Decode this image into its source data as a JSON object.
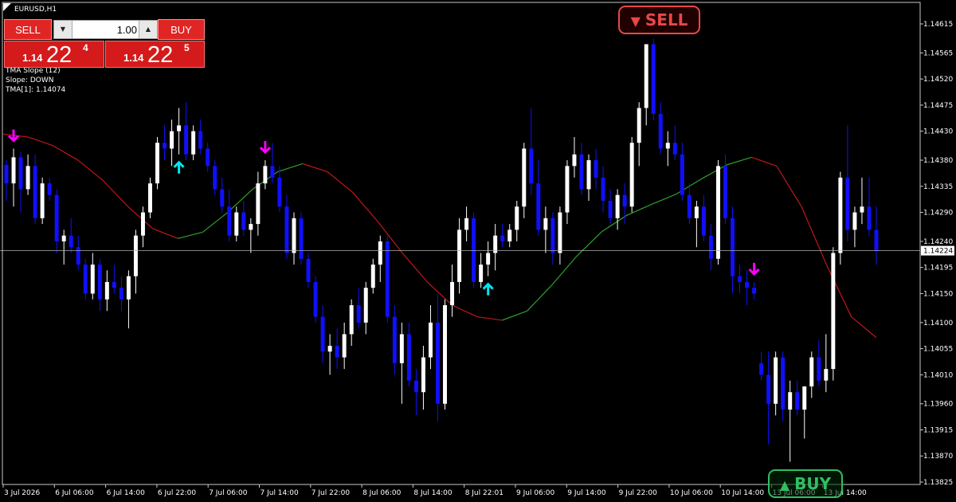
{
  "window": {
    "symbol_title": "EURUSD,H1"
  },
  "trade_panel": {
    "sell_label": "SELL",
    "buy_label": "BUY",
    "lot_value": "1.00",
    "sell_price": {
      "prefix": "1.14",
      "big": "22",
      "sup": "4"
    },
    "buy_price": {
      "prefix": "1.14",
      "big": "22",
      "sup": "5"
    }
  },
  "indicator": {
    "line1": "TMA Slope (12)",
    "line2": "Slope: DOWN",
    "line3": "TMA[1]: 1.14074"
  },
  "signals": {
    "sell_badge": "SELL",
    "buy_badge": "BUY"
  },
  "colors": {
    "background": "#000000",
    "bull_candle": "#ffffff",
    "bear_candle": "#1010ff",
    "tma_up": "#2ea02e",
    "tma_down": "#c01818",
    "arrow_down": "#ff00ff",
    "arrow_up": "#00e5ee",
    "bid_line": "#b0b0b0"
  },
  "chart_data": {
    "type": "candlestick",
    "symbol": "EURUSD",
    "timeframe": "H1",
    "current_price": "1.14224",
    "y_ticks": [
      "1.14615",
      "1.14565",
      "1.14520",
      "1.14475",
      "1.14430",
      "1.14380",
      "1.14335",
      "1.14290",
      "1.14240",
      "1.14195",
      "1.14150",
      "1.14100",
      "1.14055",
      "1.14010",
      "1.13960",
      "1.13915",
      "1.13870",
      "1.13825"
    ],
    "x_ticks": [
      "3 Jul 2026",
      "6 Jul 06:00",
      "6 Jul 14:00",
      "6 Jul 22:00",
      "7 Jul 06:00",
      "7 Jul 14:00",
      "7 Jul 22:00",
      "8 Jul 06:00",
      "8 Jul 14:00",
      "8 Jul 22:01",
      "9 Jul 06:00",
      "9 Jul 14:00",
      "9 Jul 22:00",
      "10 Jul 06:00",
      "10 Jul 14:00",
      "13 Jul 06:00",
      "13 Jul 14:00"
    ],
    "ylim": [
      1.1382,
      1.1463
    ],
    "candles": [
      [
        1.14372,
        1.1438,
        1.1431,
        1.1434
      ],
      [
        1.1434,
        1.144,
        1.143,
        1.14385
      ],
      [
        1.14385,
        1.14395,
        1.1429,
        1.1433
      ],
      [
        1.1433,
        1.1439,
        1.1432,
        1.1437
      ],
      [
        1.1437,
        1.1439,
        1.1427,
        1.1428
      ],
      [
        1.1428,
        1.1435,
        1.1427,
        1.1434
      ],
      [
        1.1434,
        1.1435,
        1.1431,
        1.1432
      ],
      [
        1.1432,
        1.1433,
        1.1422,
        1.1424
      ],
      [
        1.1424,
        1.1426,
        1.142,
        1.1425
      ],
      [
        1.1425,
        1.1428,
        1.1422,
        1.1423
      ],
      [
        1.1423,
        1.1425,
        1.1419,
        1.142
      ],
      [
        1.142,
        1.1421,
        1.1414,
        1.1415
      ],
      [
        1.1415,
        1.1422,
        1.1414,
        1.142
      ],
      [
        1.142,
        1.1421,
        1.1412,
        1.1414
      ],
      [
        1.1414,
        1.1419,
        1.1412,
        1.1417
      ],
      [
        1.1417,
        1.142,
        1.1415,
        1.1416
      ],
      [
        1.1416,
        1.1418,
        1.1412,
        1.1414
      ],
      [
        1.1414,
        1.1419,
        1.1409,
        1.1418
      ],
      [
        1.1418,
        1.1426,
        1.1415,
        1.1425
      ],
      [
        1.1425,
        1.143,
        1.1423,
        1.1429
      ],
      [
        1.1429,
        1.1435,
        1.1428,
        1.1434
      ],
      [
        1.1434,
        1.1442,
        1.1433,
        1.1441
      ],
      [
        1.1441,
        1.1444,
        1.1438,
        1.144
      ],
      [
        1.144,
        1.1445,
        1.1437,
        1.1443
      ],
      [
        1.1443,
        1.1447,
        1.1439,
        1.1444
      ],
      [
        1.1444,
        1.1448,
        1.1438,
        1.1439
      ],
      [
        1.1439,
        1.1444,
        1.1438,
        1.1443
      ],
      [
        1.1443,
        1.1445,
        1.1439,
        1.144
      ],
      [
        1.144,
        1.1441,
        1.1436,
        1.1437
      ],
      [
        1.1437,
        1.1438,
        1.1432,
        1.1433
      ],
      [
        1.1433,
        1.1435,
        1.1429,
        1.143
      ],
      [
        1.143,
        1.1433,
        1.1424,
        1.1425
      ],
      [
        1.1425,
        1.143,
        1.1424,
        1.1429
      ],
      [
        1.1429,
        1.1431,
        1.1425,
        1.1426
      ],
      [
        1.1426,
        1.1428,
        1.1422,
        1.1427
      ],
      [
        1.1427,
        1.1436,
        1.1425,
        1.1434
      ],
      [
        1.1434,
        1.1438,
        1.1433,
        1.1437
      ],
      [
        1.1437,
        1.1441,
        1.1434,
        1.1435
      ],
      [
        1.1435,
        1.1437,
        1.1429,
        1.143
      ],
      [
        1.143,
        1.1432,
        1.1421,
        1.1422
      ],
      [
        1.1422,
        1.1429,
        1.142,
        1.1428
      ],
      [
        1.1428,
        1.1429,
        1.142,
        1.1421
      ],
      [
        1.1421,
        1.1422,
        1.1416,
        1.1417
      ],
      [
        1.1417,
        1.1418,
        1.141,
        1.1411
      ],
      [
        1.1411,
        1.1413,
        1.1403,
        1.1405
      ],
      [
        1.1405,
        1.1408,
        1.1401,
        1.1406
      ],
      [
        1.1406,
        1.1409,
        1.1402,
        1.1404
      ],
      [
        1.1404,
        1.141,
        1.1402,
        1.1408
      ],
      [
        1.1408,
        1.1414,
        1.1406,
        1.1413
      ],
      [
        1.1413,
        1.1416,
        1.1409,
        1.141
      ],
      [
        1.141,
        1.1417,
        1.1408,
        1.1416
      ],
      [
        1.1416,
        1.1421,
        1.1415,
        1.142
      ],
      [
        1.142,
        1.1425,
        1.1417,
        1.1424
      ],
      [
        1.1424,
        1.1425,
        1.141,
        1.1411
      ],
      [
        1.1411,
        1.1413,
        1.1401,
        1.1403
      ],
      [
        1.1403,
        1.141,
        1.1396,
        1.1408
      ],
      [
        1.1408,
        1.141,
        1.1399,
        1.14
      ],
      [
        1.14,
        1.1402,
        1.1394,
        1.1398
      ],
      [
        1.1398,
        1.1406,
        1.1395,
        1.1404
      ],
      [
        1.1404,
        1.1413,
        1.1402,
        1.141
      ],
      [
        1.141,
        1.1415,
        1.1393,
        1.1396
      ],
      [
        1.1396,
        1.1414,
        1.1395,
        1.1413
      ],
      [
        1.1413,
        1.142,
        1.1411,
        1.1417
      ],
      [
        1.1417,
        1.1428,
        1.1415,
        1.1426
      ],
      [
        1.1426,
        1.143,
        1.1424,
        1.1428
      ],
      [
        1.1428,
        1.1429,
        1.1416,
        1.1417
      ],
      [
        1.1417,
        1.1422,
        1.1416,
        1.142
      ],
      [
        1.142,
        1.1424,
        1.1418,
        1.1422
      ],
      [
        1.1422,
        1.1427,
        1.1419,
        1.1425
      ],
      [
        1.1425,
        1.1427,
        1.1423,
        1.1424
      ],
      [
        1.1424,
        1.1427,
        1.1423,
        1.1426
      ],
      [
        1.1426,
        1.1431,
        1.1424,
        1.143
      ],
      [
        1.143,
        1.1441,
        1.1428,
        1.144
      ],
      [
        1.144,
        1.1447,
        1.1432,
        1.1434
      ],
      [
        1.1434,
        1.1438,
        1.1425,
        1.1426
      ],
      [
        1.1426,
        1.143,
        1.1422,
        1.1428
      ],
      [
        1.1428,
        1.1429,
        1.142,
        1.1422
      ],
      [
        1.1422,
        1.143,
        1.142,
        1.1429
      ],
      [
        1.1429,
        1.1438,
        1.1427,
        1.1437
      ],
      [
        1.1437,
        1.1442,
        1.1435,
        1.1439
      ],
      [
        1.1439,
        1.1441,
        1.1432,
        1.1433
      ],
      [
        1.1433,
        1.1439,
        1.1431,
        1.1438
      ],
      [
        1.1438,
        1.144,
        1.1433,
        1.1435
      ],
      [
        1.1435,
        1.1437,
        1.1429,
        1.1431
      ],
      [
        1.1431,
        1.1433,
        1.1427,
        1.1428
      ],
      [
        1.1428,
        1.1433,
        1.1426,
        1.1432
      ],
      [
        1.1432,
        1.1434,
        1.1427,
        1.143
      ],
      [
        1.143,
        1.1442,
        1.1429,
        1.1441
      ],
      [
        1.1441,
        1.1448,
        1.1437,
        1.1447
      ],
      [
        1.1447,
        1.1458,
        1.1444,
        1.1458
      ],
      [
        1.1458,
        1.1459,
        1.1445,
        1.1446
      ],
      [
        1.1446,
        1.1448,
        1.1439,
        1.144
      ],
      [
        1.144,
        1.1443,
        1.1437,
        1.1441
      ],
      [
        1.1441,
        1.1444,
        1.1438,
        1.1439
      ],
      [
        1.1439,
        1.1441,
        1.1431,
        1.1432
      ],
      [
        1.1432,
        1.1434,
        1.1427,
        1.1428
      ],
      [
        1.1428,
        1.1431,
        1.1423,
        1.143
      ],
      [
        1.143,
        1.1432,
        1.1424,
        1.1425
      ],
      [
        1.1425,
        1.1427,
        1.1419,
        1.1421
      ],
      [
        1.1421,
        1.1438,
        1.142,
        1.1437
      ],
      [
        1.1437,
        1.1439,
        1.1427,
        1.1428
      ],
      [
        1.1428,
        1.143,
        1.1415,
        1.1418
      ],
      [
        1.1418,
        1.142,
        1.1415,
        1.1417
      ],
      [
        1.1417,
        1.1419,
        1.1413,
        1.1416
      ],
      [
        1.1416,
        1.1417,
        1.1414,
        1.1415
      ],
      [
        1.1403,
        1.1405,
        1.14,
        1.1401
      ],
      [
        1.1401,
        1.1405,
        1.1389,
        1.1396
      ],
      [
        1.1396,
        1.1405,
        1.1394,
        1.1404
      ],
      [
        1.1404,
        1.1405,
        1.1393,
        1.1395
      ],
      [
        1.1395,
        1.14,
        1.1386,
        1.1398
      ],
      [
        1.1398,
        1.14,
        1.1394,
        1.1395
      ],
      [
        1.1395,
        1.1399,
        1.139,
        1.1399
      ],
      [
        1.1399,
        1.1405,
        1.1397,
        1.1404
      ],
      [
        1.1404,
        1.1407,
        1.1399,
        1.14
      ],
      [
        1.14,
        1.1408,
        1.1398,
        1.1402
      ],
      [
        1.1402,
        1.1423,
        1.14,
        1.1422
      ],
      [
        1.1422,
        1.1436,
        1.142,
        1.1435
      ],
      [
        1.1435,
        1.1444,
        1.1424,
        1.1426
      ],
      [
        1.1426,
        1.143,
        1.1423,
        1.1429
      ],
      [
        1.1429,
        1.1435,
        1.1427,
        1.143
      ],
      [
        1.143,
        1.1435,
        1.1425,
        1.1426
      ],
      [
        1.1426,
        1.143,
        1.142,
        1.14224
      ]
    ],
    "tma_line": [
      1.14425,
      1.1442,
      1.14405,
      1.1438,
      1.14345,
      1.143,
      1.14262,
      1.14245,
      1.14256,
      1.1429,
      1.1433,
      1.1436,
      1.14374,
      1.1436,
      1.14325,
      1.14275,
      1.1422,
      1.1417,
      1.1413,
      1.1411,
      1.14104,
      1.1412,
      1.14165,
      1.14215,
      1.14257,
      1.14285,
      1.14304,
      1.14322,
      1.14348,
      1.14372,
      1.14385,
      1.1437,
      1.143,
      1.142,
      1.1411,
      1.14074
    ],
    "signal_arrows": [
      {
        "dir": "down",
        "bar": 1
      },
      {
        "dir": "up",
        "bar": 24
      },
      {
        "dir": "down",
        "bar": 36
      },
      {
        "dir": "up",
        "bar": 67
      },
      {
        "dir": "down",
        "bar": 104
      }
    ]
  }
}
